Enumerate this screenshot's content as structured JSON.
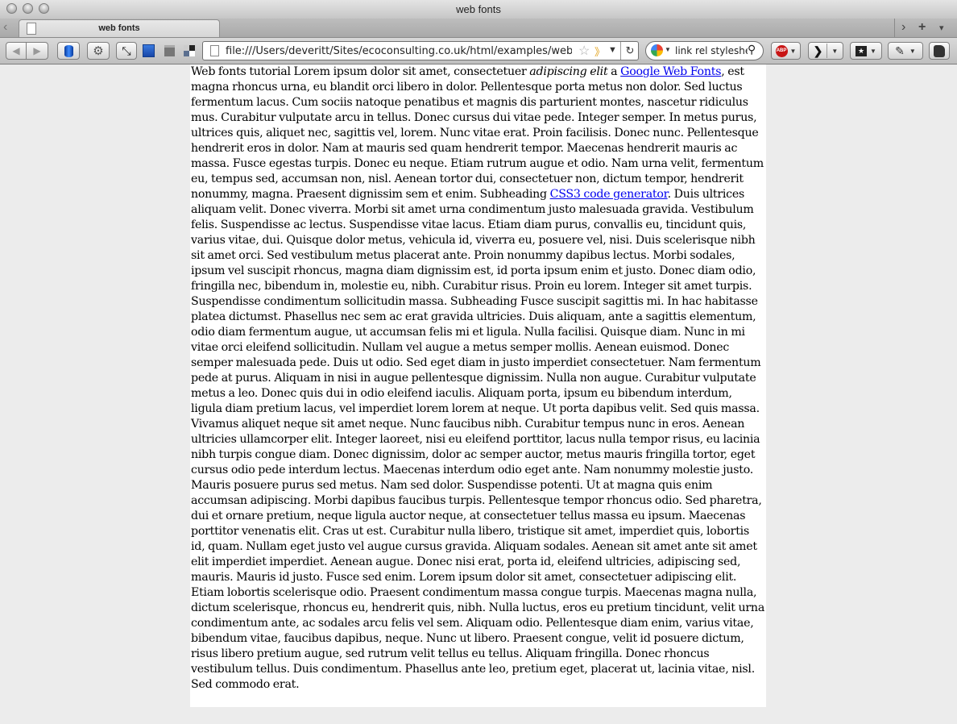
{
  "window": {
    "title": "web fonts"
  },
  "tabs": [
    {
      "label": "web fonts"
    }
  ],
  "toolbar": {
    "url": "file:///Users/deveritt/Sites/ecoconsulting.co.uk/html/examples/webtypo",
    "search": "link rel styleshe",
    "abp_label": "ABP"
  },
  "content": {
    "seg1": "Web fonts tutorial Lorem ipsum dolor sit amet, consectetuer ",
    "em1": "adipiscing elit",
    "seg2": " a ",
    "link1": "Google Web Fonts",
    "seg3": ", est magna rhoncus urna, eu blandit orci libero in dolor. Pellentesque porta metus non dolor. Sed luctus fermentum lacus. Cum sociis natoque penatibus et magnis dis parturient montes, nascetur ridiculus mus. Curabitur vulputate arcu in tellus. Donec cursus dui vitae pede. Integer semper. In metus purus, ultrices quis, aliquet nec, sagittis vel, lorem. Nunc vitae erat. Proin facilisis. Donec nunc. Pellentesque hendrerit eros in dolor. Nam at mauris sed quam hendrerit tempor. Maecenas hendrerit mauris ac massa. Fusce egestas turpis. Donec eu neque. Etiam rutrum augue et odio. Nam urna velit, fermentum eu, tempus sed, accumsan non, nisl. Aenean tortor dui, consectetuer non, dictum tempor, hendrerit nonummy, magna. Praesent dignissim sem et enim. Subheading ",
    "link2": "CSS3 code generator",
    "seg4": ". Duis ultrices aliquam velit. Donec viverra. Morbi sit amet urna condimentum justo malesuada gravida. Vestibulum felis. Suspendisse ac lectus. Suspendisse vitae lacus. Etiam diam purus, convallis eu, tincidunt quis, varius vitae, dui. Quisque dolor metus, vehicula id, viverra eu, posuere vel, nisi. Duis scelerisque nibh sit amet orci. Sed vestibulum metus placerat ante. Proin nonummy dapibus lectus. Morbi sodales, ipsum vel suscipit rhoncus, magna diam dignissim est, id porta ipsum enim et justo. Donec diam odio, fringilla nec, bibendum in, molestie eu, nibh. Curabitur risus. Proin eu lorem. Integer sit amet turpis. Suspendisse condimentum sollicitudin massa. Subheading Fusce suscipit sagittis mi. In hac habitasse platea dictumst. Phasellus nec sem ac erat gravida ultricies. Duis aliquam, ante a sagittis elementum, odio diam fermentum augue, ut accumsan felis mi et ligula. Nulla facilisi. Quisque diam. Nunc in mi vitae orci eleifend sollicitudin. Nullam vel augue a metus semper mollis. Aenean euismod. Donec semper malesuada pede. Duis ut odio. Sed eget diam in justo imperdiet consectetuer. Nam fermentum pede at purus. Aliquam in nisi in augue pellentesque dignissim. Nulla non augue. Curabitur vulputate metus a leo. Donec quis dui in odio eleifend iaculis. Aliquam porta, ipsum eu bibendum interdum, ligula diam pretium lacus, vel imperdiet lorem lorem at neque. Ut porta dapibus velit. Sed quis massa. Vivamus aliquet neque sit amet neque. Nunc faucibus nibh. Curabitur tempus nunc in eros. Aenean ultricies ullamcorper elit. Integer laoreet, nisi eu eleifend porttitor, lacus nulla tempor risus, eu lacinia nibh turpis congue diam. Donec dignissim, dolor ac semper auctor, metus mauris fringilla tortor, eget cursus odio pede interdum lectus. Maecenas interdum odio eget ante. Nam nonummy molestie justo. Mauris posuere purus sed metus. Nam sed dolor. Suspendisse potenti. Ut at magna quis enim accumsan adipiscing. Morbi dapibus faucibus turpis. Pellentesque tempor rhoncus odio. Sed pharetra, dui et ornare pretium, neque ligula auctor neque, at consectetuer tellus massa eu ipsum. Maecenas porttitor venenatis elit. Cras ut est. Curabitur nulla libero, tristique sit amet, imperdiet quis, lobortis id, quam. Nullam eget justo vel augue cursus gravida. Aliquam sodales. Aenean sit amet ante sit amet elit imperdiet imperdiet. Aenean augue. Donec nisi erat, porta id, eleifend ultricies, adipiscing sed, mauris. Mauris id justo. Fusce sed enim. Lorem ipsum dolor sit amet, consectetuer adipiscing elit. Etiam lobortis scelerisque odio. Praesent condimentum massa congue turpis. Maecenas magna nulla, dictum scelerisque, rhoncus eu, hendrerit quis, nibh. Nulla luctus, eros eu pretium tincidunt, velit urna condimentum ante, ac sodales arcu felis vel sem. Aliquam odio. Pellentesque diam enim, varius vitae, bibendum vitae, faucibus dapibus, neque. Nunc ut libero. Praesent congue, velit id posuere dictum, risus libero pretium augue, sed rutrum velit tellus eu tellus. Aliquam fringilla. Donec rhoncus vestibulum tellus. Duis condimentum. Phasellus ante leo, pretium eget, placerat ut, lacinia vitae, nisl. Sed commodo erat."
  },
  "colors": {
    "link": "#0000ee",
    "page_bg": "#ffffff",
    "window_bg": "#ececec"
  }
}
